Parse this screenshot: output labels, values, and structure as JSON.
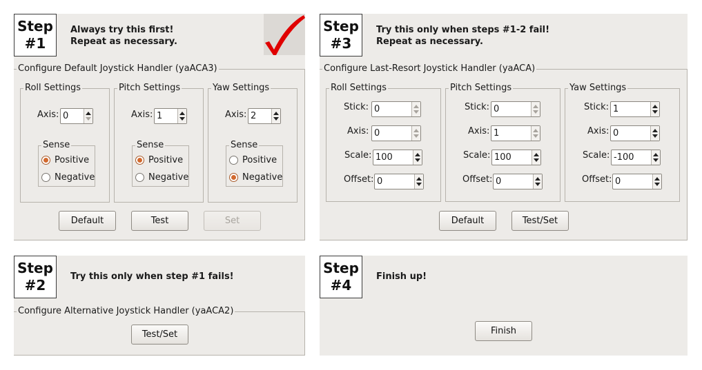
{
  "step1": {
    "num": "Step",
    "sub": "#1",
    "msg1": "Always try this first!",
    "msg2": "Repeat as necessary.",
    "frame_title": "Configure Default Joystick Handler (yaACA3)",
    "roll": {
      "title": "Roll Settings",
      "axis_label": "Axis:",
      "axis_value": "0",
      "sense_title": "Sense",
      "positive": "Positive",
      "negative": "Negative",
      "selected": "positive"
    },
    "pitch": {
      "title": "Pitch Settings",
      "axis_label": "Axis:",
      "axis_value": "1",
      "sense_title": "Sense",
      "positive": "Positive",
      "negative": "Negative",
      "selected": "positive"
    },
    "yaw": {
      "title": "Yaw Settings",
      "axis_label": "Axis:",
      "axis_value": "2",
      "sense_title": "Sense",
      "positive": "Positive",
      "negative": "Negative",
      "selected": "negative"
    },
    "default_btn": "Default",
    "test_btn": "Test",
    "set_btn": "Set",
    "checkmark_color": "#e00000"
  },
  "step2": {
    "num": "Step",
    "sub": "#2",
    "msg1": "Try this only when step #1 fails!",
    "frame_title": "Configure Alternative Joystick Handler (yaACA2)",
    "testset_btn": "Test/Set"
  },
  "step3": {
    "num": "Step",
    "sub": "#3",
    "msg1": "Try this only when steps #1-2 fail!",
    "msg2": "Repeat as necessary.",
    "frame_title": "Configure Last-Resort Joystick Handler (yaACA)",
    "labels": {
      "stick": "Stick:",
      "axis": "Axis:",
      "scale": "Scale:",
      "offset": "Offset:"
    },
    "roll": {
      "title": "Roll Settings",
      "stick": "0",
      "axis": "0",
      "scale": "100",
      "offset": "0"
    },
    "pitch": {
      "title": "Pitch Settings",
      "stick": "0",
      "axis": "1",
      "scale": "100",
      "offset": "0"
    },
    "yaw": {
      "title": "Yaw Settings",
      "stick": "1",
      "axis": "0",
      "scale": "-100",
      "offset": "0"
    },
    "default_btn": "Default",
    "testset_btn": "Test/Set"
  },
  "step4": {
    "num": "Step",
    "sub": "#4",
    "msg1": "Finish up!",
    "finish_btn": "Finish"
  }
}
